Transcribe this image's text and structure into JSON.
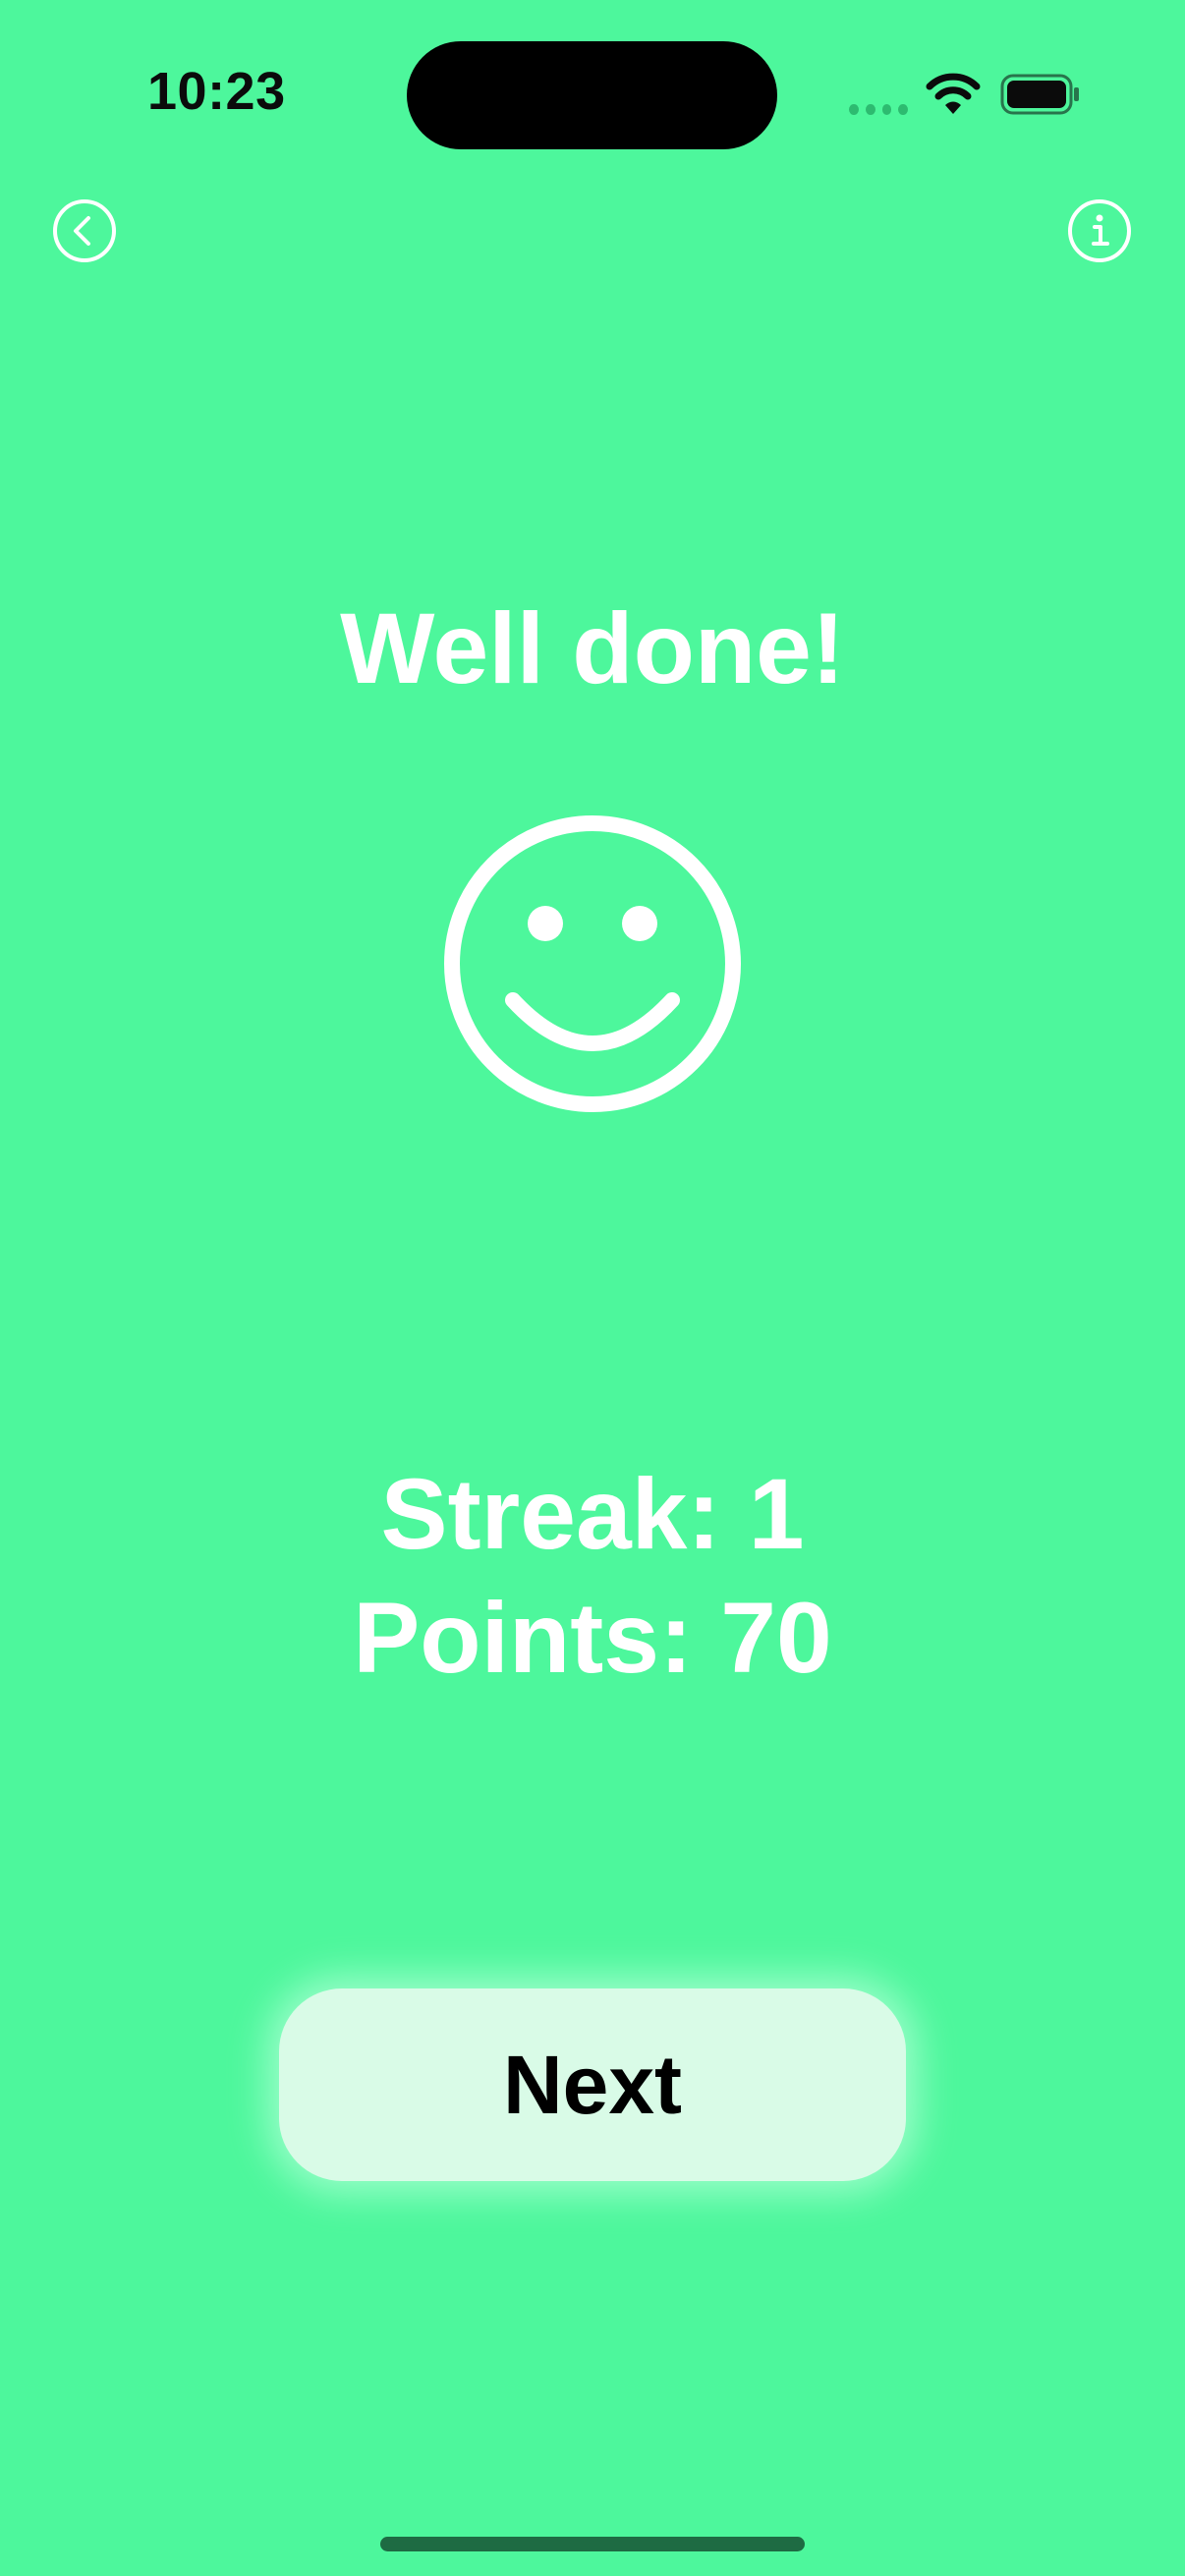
{
  "status_bar": {
    "time": "10:23"
  },
  "nav": {
    "back_icon": "chevron-left-circle-icon",
    "info_icon": "info-circle-icon"
  },
  "result": {
    "title": "Well done!",
    "icon": "smiley-face-icon"
  },
  "stats": {
    "streak": "Streak: 1",
    "points": "Points: 70"
  },
  "actions": {
    "next_label": "Next"
  },
  "colors": {
    "background": "#4DF79C",
    "button_background": "#D9FBE7",
    "text_light": "#FFFFFF",
    "text_dark": "#000000"
  }
}
